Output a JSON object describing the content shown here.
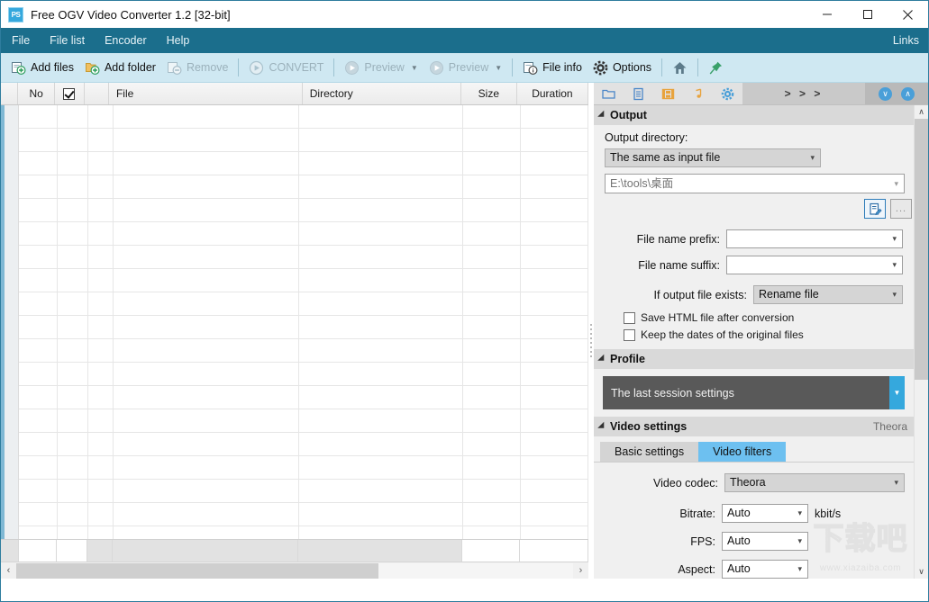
{
  "window": {
    "title": "Free OGV Video Converter 1.2  [32-bit]",
    "app_icon": "ps-app-icon",
    "minimize": "—",
    "maximize": "□",
    "close": "✕"
  },
  "menubar": {
    "items": [
      {
        "label": "File",
        "name": "menu-file"
      },
      {
        "label": "File list",
        "name": "menu-file-list"
      },
      {
        "label": "Encoder",
        "name": "menu-encoder"
      },
      {
        "label": "Help",
        "name": "menu-help"
      }
    ],
    "right_label": "Links"
  },
  "toolbar": {
    "items": [
      {
        "label": "Add files",
        "icon": "add-files-icon",
        "disabled": false,
        "caret": false
      },
      {
        "label": "Add folder",
        "icon": "add-folder-icon",
        "disabled": false,
        "caret": false
      },
      {
        "label": "Remove",
        "icon": "remove-icon",
        "disabled": true,
        "caret": false
      },
      {
        "label": "CONVERT",
        "icon": "convert-icon",
        "disabled": true,
        "caret": false
      },
      {
        "label": "Preview",
        "icon": "preview-icon",
        "disabled": true,
        "caret": true
      },
      {
        "label": "Preview",
        "icon": "preview-icon",
        "disabled": true,
        "caret": true
      },
      {
        "label": "File info",
        "icon": "file-info-icon",
        "disabled": false,
        "caret": false
      },
      {
        "label": "Options",
        "icon": "gear-icon",
        "disabled": false,
        "caret": false
      }
    ],
    "home_icon": "home-icon",
    "pin_icon": "pin-icon"
  },
  "filelist": {
    "columns": [
      {
        "label": "",
        "name": "column-corner"
      },
      {
        "label": "No",
        "name": "column-no"
      },
      {
        "label": "",
        "name": "column-checkbox"
      },
      {
        "label": "",
        "name": "column-icon"
      },
      {
        "label": "File",
        "name": "column-file"
      },
      {
        "label": "Directory",
        "name": "column-directory"
      },
      {
        "label": "Size",
        "name": "column-size"
      },
      {
        "label": "Duration",
        "name": "column-duration"
      }
    ],
    "rows": [],
    "hscroll": {
      "left_arrow": "‹",
      "right_arrow": "›"
    }
  },
  "right_panel": {
    "toolbar": {
      "buttons": [
        {
          "icon": "folder-icon",
          "name": "rp-tab-output"
        },
        {
          "icon": "document-icon",
          "name": "rp-tab-profile"
        },
        {
          "icon": "film-icon",
          "name": "rp-tab-video"
        },
        {
          "icon": "music-note-icon",
          "name": "rp-tab-audio"
        },
        {
          "icon": "gear-icon",
          "name": "rp-tab-settings"
        }
      ],
      "arrows_label": "> > >",
      "circle_down": "∨",
      "circle_up": "∧"
    },
    "output": {
      "section_title": "Output",
      "directory_label": "Output directory:",
      "directory_mode": "The same as input file",
      "directory_path": "E:\\tools\\桌面",
      "edit_button_icon": "edit-path-icon",
      "browse_button_label": "...",
      "prefix_label": "File name prefix:",
      "prefix_value": "",
      "suffix_label": "File name suffix:",
      "suffix_value": "",
      "exists_label": "If output file exists:",
      "exists_value": "Rename file",
      "checkboxes": [
        {
          "label": "Save HTML file after conversion",
          "checked": false
        },
        {
          "label": "Keep the dates of the original files",
          "checked": false
        }
      ]
    },
    "profile": {
      "section_title": "Profile",
      "selected": "The last session settings"
    },
    "video_settings": {
      "section_title": "Video settings",
      "codec_note": "Theora",
      "tabs": [
        {
          "label": "Basic settings",
          "active": false
        },
        {
          "label": "Video filters",
          "active": true
        }
      ],
      "fields": [
        {
          "label": "Video codec:",
          "value": "Theora",
          "unit": "",
          "style": "gray"
        },
        {
          "label": "Bitrate:",
          "value": "Auto",
          "unit": "kbit/s",
          "style": "white"
        },
        {
          "label": "FPS:",
          "value": "Auto",
          "unit": "",
          "style": "white"
        },
        {
          "label": "Aspect:",
          "value": "Auto",
          "unit": "",
          "style": "white"
        }
      ]
    },
    "scrollbar": {
      "up": "∧",
      "down": "∨"
    }
  },
  "watermark": {
    "text": "下载吧",
    "url": "www.xiazaiba.com"
  },
  "colors": {
    "titlebar_accent": "#1b6e8c",
    "toolbar_bg": "#cfe8f2",
    "tab_active": "#6dc0f0",
    "profile_bg": "#595959",
    "profile_drop": "#35a8dd",
    "circle_btn": "#4a9fd8"
  }
}
